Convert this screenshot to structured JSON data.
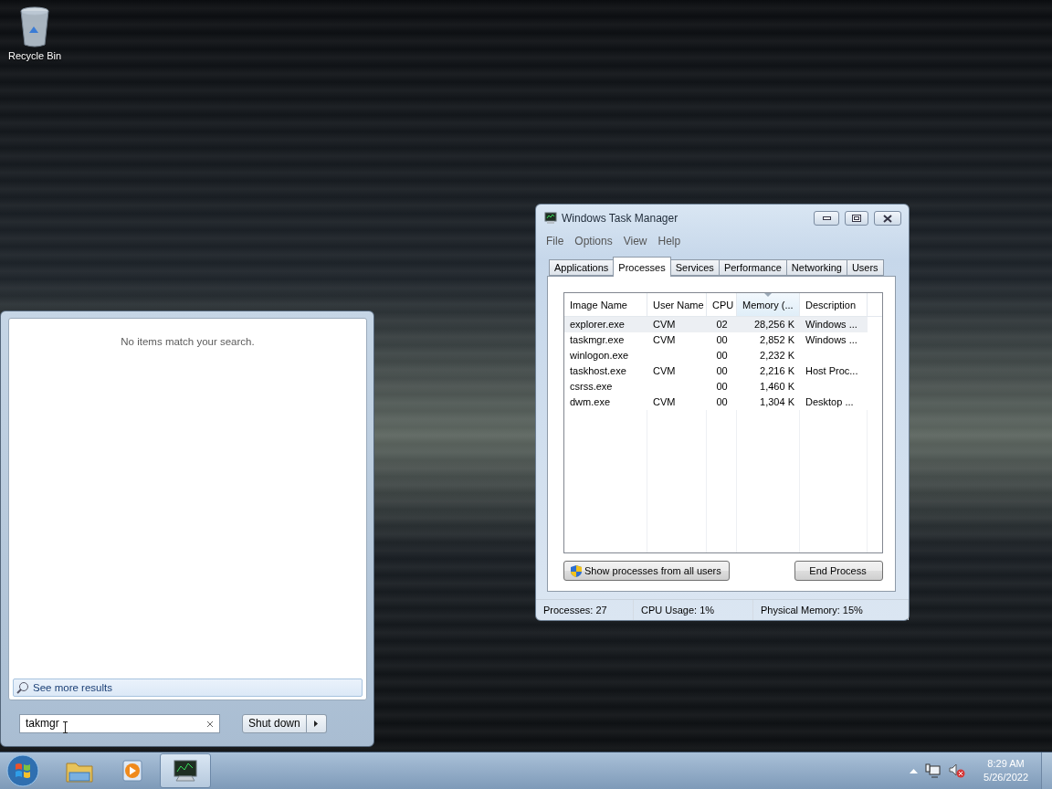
{
  "desktop": {
    "icons": [
      {
        "label": "Recycle Bin",
        "kind": "recycle"
      }
    ]
  },
  "task_manager": {
    "title": "Windows Task Manager",
    "menu": [
      "File",
      "Options",
      "View",
      "Help"
    ],
    "tabs": [
      {
        "label": "Applications",
        "selected": false
      },
      {
        "label": "Processes",
        "selected": true
      },
      {
        "label": "Services",
        "selected": false
      },
      {
        "label": "Performance",
        "selected": false
      },
      {
        "label": "Networking",
        "selected": false
      },
      {
        "label": "Users",
        "selected": false
      }
    ],
    "columns": [
      {
        "label": "Image Name",
        "sorted": false
      },
      {
        "label": "User Name",
        "sorted": false
      },
      {
        "label": "CPU",
        "sorted": false
      },
      {
        "label": "Memory (...",
        "sorted": true
      },
      {
        "label": "Description",
        "sorted": false
      }
    ],
    "rows": [
      {
        "cells": [
          "explorer.exe",
          "CVM",
          "02",
          "28,256 K",
          "Windows ..."
        ],
        "selected": true
      },
      {
        "cells": [
          "taskmgr.exe",
          "CVM",
          "00",
          "2,852 K",
          "Windows ..."
        ],
        "selected": false
      },
      {
        "cells": [
          "winlogon.exe",
          "",
          "00",
          "2,232 K",
          ""
        ],
        "selected": false
      },
      {
        "cells": [
          "taskhost.exe",
          "CVM",
          "00",
          "2,216 K",
          "Host Proc..."
        ],
        "selected": false
      },
      {
        "cells": [
          "csrss.exe",
          "",
          "00",
          "1,460 K",
          ""
        ],
        "selected": false
      },
      {
        "cells": [
          "dwm.exe",
          "CVM",
          "00",
          "1,304 K",
          "Desktop ..."
        ],
        "selected": false
      }
    ],
    "show_all_button": "Show processes from all users",
    "end_button": "End Process",
    "status_bar": [
      "Processes: 27",
      "CPU Usage: 1%",
      "Physical Memory: 15%"
    ]
  },
  "start_menu": {
    "message": "No items match your search.",
    "see_more": "See more results",
    "search": {
      "value": "takmgr"
    },
    "shutdown": "Shut down"
  },
  "taskbar": {
    "apps": [
      {
        "kind": "folder",
        "active": false
      },
      {
        "kind": "media",
        "active": false
      },
      {
        "kind": "taskmgr",
        "active": true
      }
    ],
    "clock": {
      "time": "8:29 AM",
      "date": "5/26/2022"
    }
  }
}
